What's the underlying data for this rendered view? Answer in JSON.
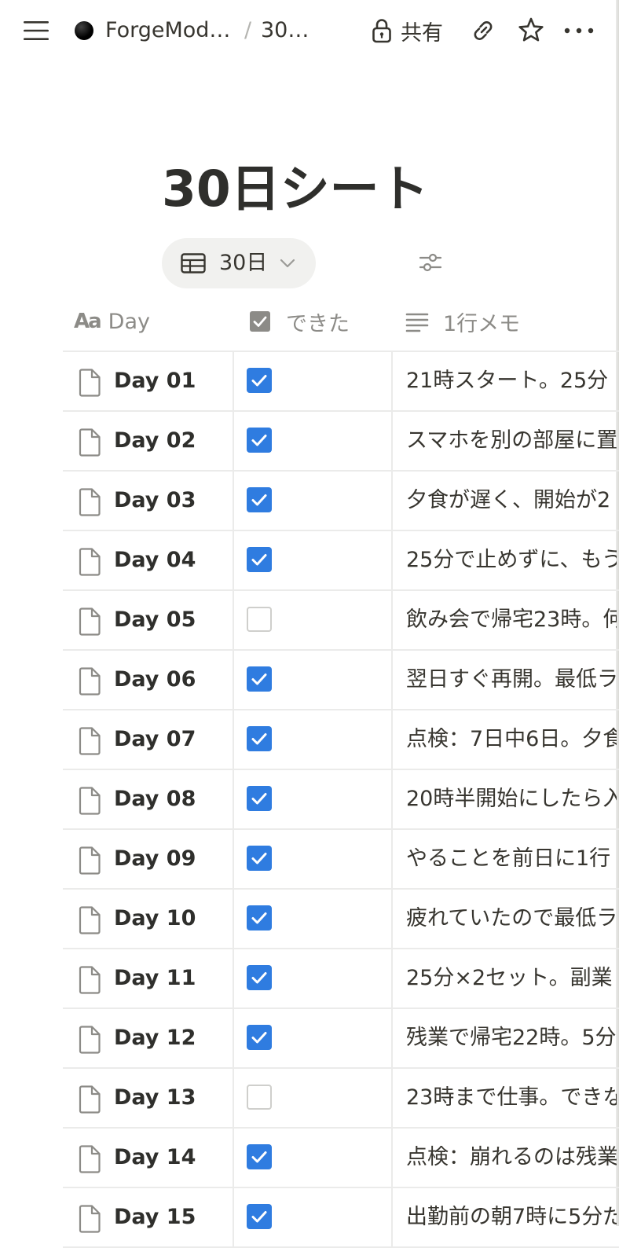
{
  "topbar": {
    "menu_icon": "hamburger-menu-icon",
    "workspace_name": "ForgeMod…",
    "separator": "/",
    "page_name": "30…",
    "share_label": "共有",
    "icons": [
      "lock-icon",
      "link-icon",
      "star-icon",
      "more-icon"
    ]
  },
  "page": {
    "title": "30日シート"
  },
  "view": {
    "tab_label": "30日",
    "tab_icon": "table-icon",
    "filter_icon": "sliders-icon"
  },
  "table": {
    "columns": [
      {
        "label": "Day",
        "icon": "text-property-icon"
      },
      {
        "label": "できた",
        "icon": "checkbox-property-icon"
      },
      {
        "label": "1行メモ",
        "icon": "lines-property-icon"
      }
    ],
    "rows": [
      {
        "day": "Day 01",
        "done": true,
        "memo": "21時スタート。25分"
      },
      {
        "day": "Day 02",
        "done": true,
        "memo": "スマホを別の部屋に置"
      },
      {
        "day": "Day 03",
        "done": true,
        "memo": "夕食が遅く、開始が2"
      },
      {
        "day": "Day 04",
        "done": true,
        "memo": "25分で止めずに、もう"
      },
      {
        "day": "Day 05",
        "done": false,
        "memo": "飲み会で帰宅23時。何"
      },
      {
        "day": "Day 06",
        "done": true,
        "memo": "翌日すぐ再開。最低ラ"
      },
      {
        "day": "Day 07",
        "done": true,
        "memo": "点検：7日中6日。夕食"
      },
      {
        "day": "Day 08",
        "done": true,
        "memo": "20時半開始にしたら入"
      },
      {
        "day": "Day 09",
        "done": true,
        "memo": "やることを前日に1行"
      },
      {
        "day": "Day 10",
        "done": true,
        "memo": "疲れていたので最低ラ"
      },
      {
        "day": "Day 11",
        "done": true,
        "memo": "25分×2セット。副業"
      },
      {
        "day": "Day 12",
        "done": true,
        "memo": "残業で帰宅22時。5分"
      },
      {
        "day": "Day 13",
        "done": false,
        "memo": "23時まで仕事。できな"
      },
      {
        "day": "Day 14",
        "done": true,
        "memo": "点検：崩れるのは残業"
      },
      {
        "day": "Day 15",
        "done": true,
        "memo": "出勤前の朝7時に5分だ"
      }
    ]
  },
  "colors": {
    "checkbox_checked": "#2f7ce0",
    "text": "#37352f",
    "muted": "#8c8b87",
    "divider": "#ebebea"
  }
}
